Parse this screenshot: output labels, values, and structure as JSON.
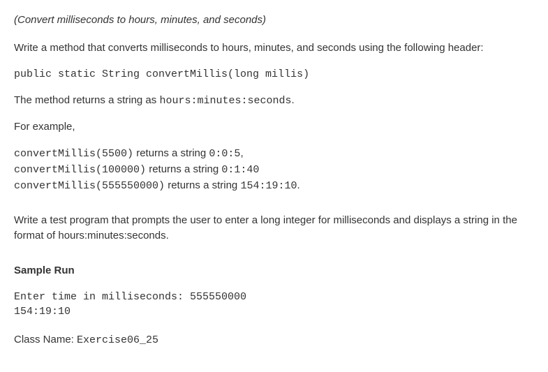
{
  "title": "(Convert milliseconds to hours, minutes, and seconds)",
  "intro": "Write a method that converts milliseconds to hours, minutes, and seconds using the following header:",
  "method_signature": "public static String convertMillis(long millis)",
  "returns_pre": "The method returns a string as ",
  "returns_code": "hours:minutes:seconds",
  "returns_post": ".",
  "for_example": "For example,",
  "examples": [
    {
      "call": "convertMillis(5500)",
      "mid": " returns a string ",
      "result": "0:0:5",
      "tail": ","
    },
    {
      "call": "convertMillis(100000)",
      "mid": "  returns a string ",
      "result": "0:1:40",
      "tail": ""
    },
    {
      "call": "convertMillis(555550000)",
      "mid": "  returns a string ",
      "result": "154:19:10",
      "tail": "."
    }
  ],
  "test_program": "Write a test program that prompts the user to enter a long integer for milliseconds and displays a string in the format of hours:minutes:seconds.",
  "sample_run_heading": "Sample Run",
  "sample_run": "Enter time in milliseconds: 555550000\n154:19:10",
  "class_name_label": "Class Name: ",
  "class_name_value": "Exercise06_25"
}
